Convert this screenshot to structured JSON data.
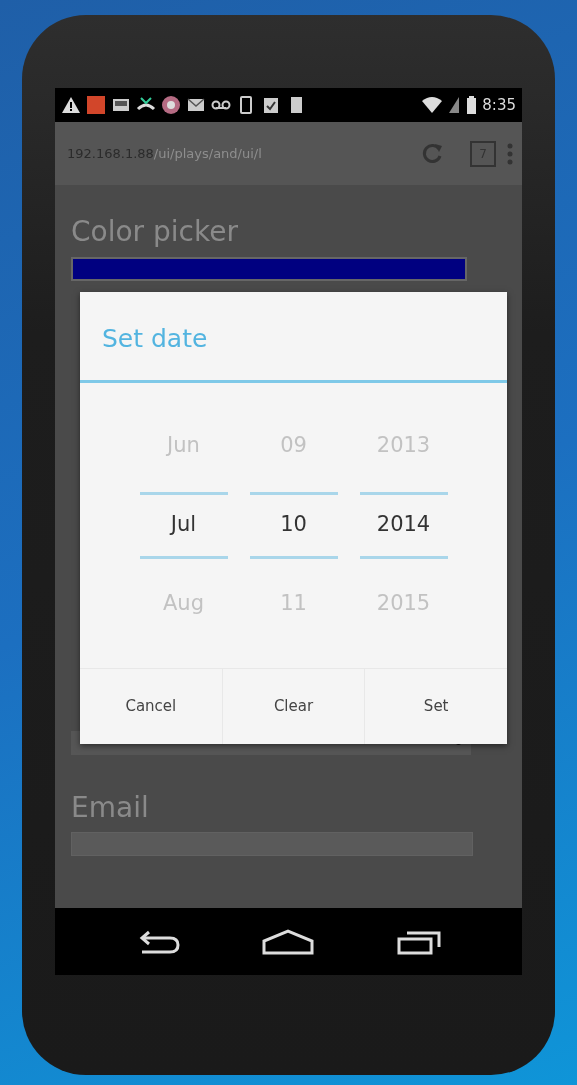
{
  "status_bar": {
    "time": "8:35"
  },
  "browser": {
    "url_host": "192.168.1.88",
    "url_path": "/ui/plays/and/ui/l",
    "tab_count": "7"
  },
  "page": {
    "fields": [
      {
        "kind": "color",
        "label": "Color picker",
        "color": "#000080"
      },
      {
        "kind": "select"
      },
      {
        "kind": "text",
        "label": "Email"
      }
    ]
  },
  "dialog": {
    "title": "Set date",
    "columns": [
      {
        "items": [
          {
            "text": "Jun",
            "selected": false
          },
          {
            "text": "Jul",
            "selected": true
          },
          {
            "text": "Aug",
            "selected": false
          }
        ]
      },
      {
        "items": [
          {
            "text": "09",
            "selected": false
          },
          {
            "text": "10",
            "selected": true
          },
          {
            "text": "11",
            "selected": false
          }
        ]
      },
      {
        "items": [
          {
            "text": "2013",
            "selected": false
          },
          {
            "text": "2014",
            "selected": true
          },
          {
            "text": "2015",
            "selected": false
          }
        ]
      }
    ],
    "buttons": [
      "Cancel",
      "Clear",
      "Set"
    ]
  }
}
